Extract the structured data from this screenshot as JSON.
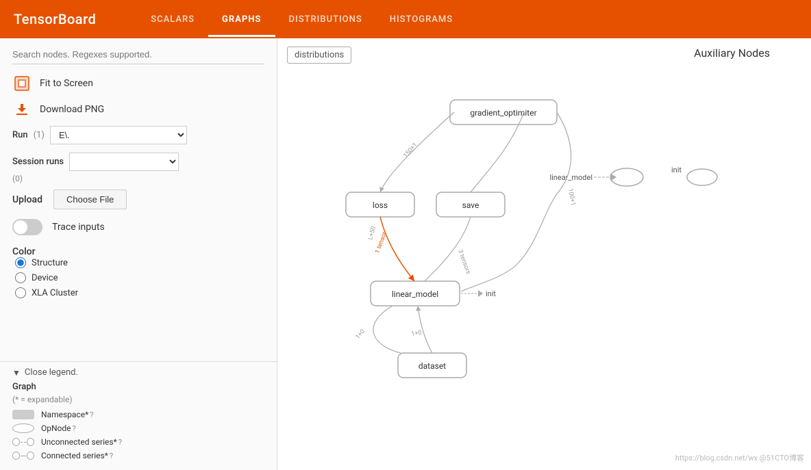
{
  "brand": "TensorBoard",
  "nav": {
    "links": [
      {
        "label": "SCALARS",
        "active": false
      },
      {
        "label": "GRAPHS",
        "active": true
      },
      {
        "label": "DISTRIBUTIONS",
        "active": false
      },
      {
        "label": "HISTOGRAMS",
        "active": false
      }
    ]
  },
  "sidebar": {
    "search_placeholder": "Search nodes. Regexes supported.",
    "fit_to_screen": "Fit to Screen",
    "download_png": "Download PNG",
    "run_label": "Run",
    "run_count": "(1)",
    "run_value": "E\\.",
    "session_runs_label": "Session runs",
    "session_count": "(0)",
    "upload_label": "Upload",
    "choose_file_label": "Choose File",
    "trace_inputs_label": "Trace inputs",
    "color_label": "Color",
    "color_options": [
      {
        "label": "Structure",
        "selected": true
      },
      {
        "label": "Device",
        "selected": false
      },
      {
        "label": "XLA Cluster",
        "selected": false
      }
    ]
  },
  "legend": {
    "toggle_label": "Close legend.",
    "graph_label": "Graph",
    "graph_subtitle": "(* = expandable)",
    "items": [
      {
        "shape": "namespace",
        "label": "Namespace*",
        "has_question": true
      },
      {
        "shape": "opnode",
        "label": "OpNode",
        "has_question": true
      },
      {
        "shape": "unconnected",
        "label": "Unconnected series*",
        "has_question": true
      },
      {
        "shape": "connected",
        "label": "Connected series*",
        "has_question": true
      }
    ]
  },
  "graph": {
    "tooltip_label": "distributions",
    "aux_nodes_title": "Auxiliary Nodes",
    "nodes": [
      {
        "id": "gradient_optimiter",
        "label": "gradient_optimiter"
      },
      {
        "id": "loss",
        "label": "loss"
      },
      {
        "id": "save",
        "label": "save"
      },
      {
        "id": "linear_model",
        "label": "linear_model"
      },
      {
        "id": "dataset",
        "label": "dataset"
      },
      {
        "id": "init",
        "label": "init"
      }
    ],
    "aux_linear_model": "linear_model",
    "aux_init": "init"
  },
  "watermark": "https://blog.csdn.net/wx @51CTO博客"
}
